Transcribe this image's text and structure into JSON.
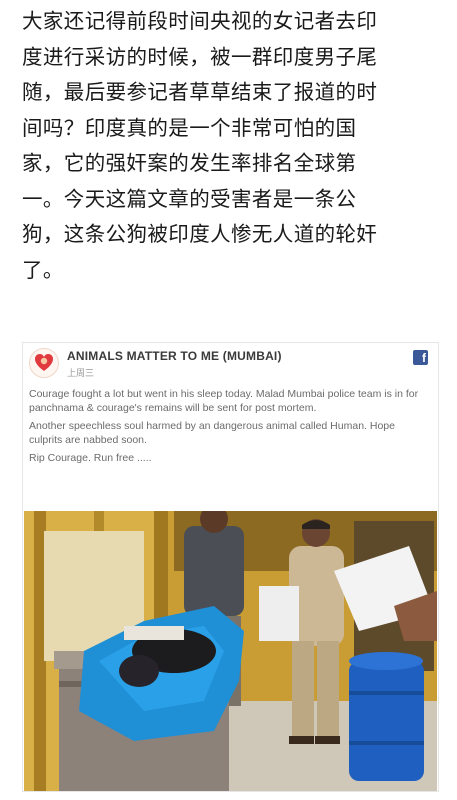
{
  "article": {
    "lines": [
      "大家还记得前段时间央视的女记者去印",
      "度进行采访的时候，被一群印度男子尾",
      "随，最后要参记者草草结束了报道的时",
      "间吗？印度真的是一个非常可怕的国",
      "家，它的强奸案的发生率排名全球第",
      "一。今天这篇文章的受害者是一条公",
      "狗，这条公狗被印度人惨无人道的轮奸",
      "了。"
    ]
  },
  "post": {
    "page_name": "ANIMALS MATTER TO ME (MUMBAI)",
    "time": "上周三",
    "paragraphs": [
      "Courage fought a lot but went in his sleep today. Malad Mumbai police team is in for panchnama & courage's remains will be sent for post mortem.",
      "Another speechless soul harmed by an dangerous animal called Human. Hope culprits are nabbed soon.",
      "Rip Courage. Run free ....."
    ],
    "fb_glyph": "f",
    "icons": {
      "platform": "facebook-icon",
      "avatar": "heart-logo-icon"
    }
  },
  "colors": {
    "facebook_blue": "#3b5998",
    "cloth_blue": "#1f8fd6",
    "uniform_khaki": "#cdb895",
    "booth_yellow": "#d7ad3a"
  }
}
